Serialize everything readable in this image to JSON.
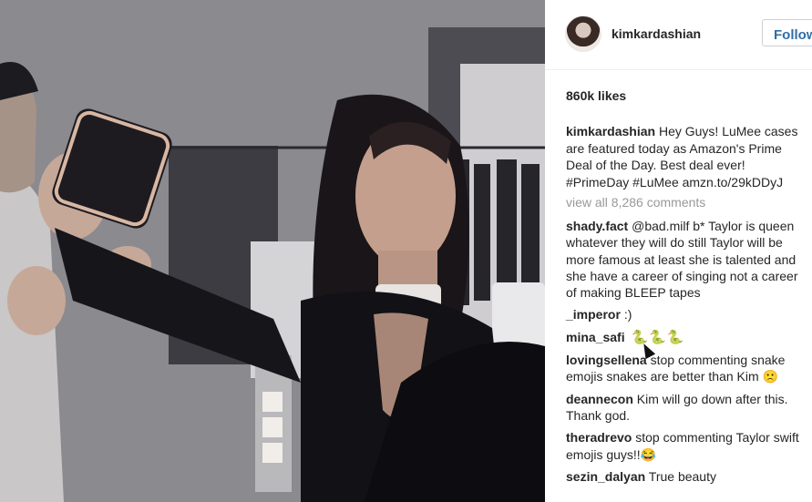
{
  "post": {
    "username": "kimkardashian",
    "follow_label": "Follow",
    "likes": "860k likes",
    "caption": {
      "user": "kimkardashian",
      "text": "Hey Guys! LuMee cases are featured today as Amazon's Prime Deal of the Day. Best deal ever! #PrimeDay #LuMee amzn.to/29kDDyJ"
    },
    "view_all": "view all 8,286 comments"
  },
  "comments": [
    {
      "user": "shady.fact",
      "text": "@bad.milf b* Taylor is queen whatever they will do still Taylor will be more famous at least she is talented and she have a career of singing not a career of making BLEEP tapes"
    },
    {
      "user": "_imperor",
      "text": ":)"
    },
    {
      "user": "mina_safi",
      "text": "🐍🐍🐍"
    },
    {
      "user": "lovingsellena",
      "text": "stop commenting snake emojis snakes are better than Kim 🙁"
    },
    {
      "user": "deannecon",
      "text": "Kim will go down after this. Thank god."
    },
    {
      "user": "theradrevo",
      "text": "stop commenting Taylor swift emojis guys!!😂"
    },
    {
      "user": "sezin_dalyan",
      "text": "True beauty"
    }
  ],
  "colors": {
    "link": "#2f6ea8",
    "muted": "#999999",
    "text": "#262626"
  },
  "icons": {
    "cursor": "arrow-cursor-icon",
    "avatar": "profile-avatar"
  }
}
